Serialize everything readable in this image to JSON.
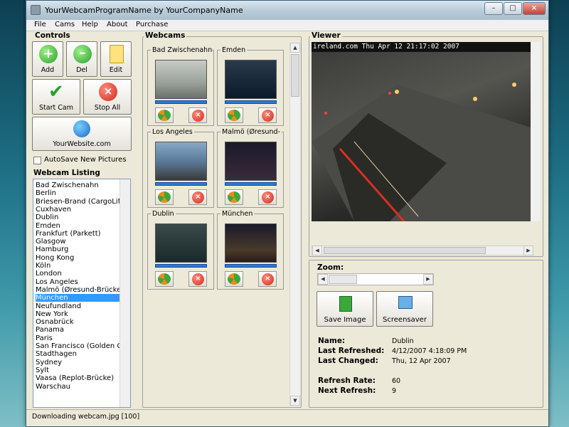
{
  "window": {
    "title": "YourWebcamProgramName by YourCompanyName",
    "min": "–",
    "max": "□",
    "close": "×"
  },
  "menu": [
    "File",
    "Cams",
    "Help",
    "About",
    "Purchase"
  ],
  "controls": {
    "title": "Controls",
    "add": "Add",
    "del": "Del",
    "edit": "Edit",
    "start": "Start Cam",
    "stop": "Stop All",
    "website": "YourWebsite.com",
    "autosave": "AutoSave New Pictures"
  },
  "listing": {
    "title": "Webcam Listing",
    "items": [
      "Bad Zwischenahn",
      "Berlin",
      "Briesen-Brand (CargoLifte",
      "Cuxhaven",
      "Dublin",
      "Emden",
      "Frankfurt (Parkett)",
      "Glasgow",
      "Hamburg",
      "Hong Kong",
      "Köln",
      "London",
      "Los Angeles",
      "Malmö (Øresund-Brücke)",
      "München",
      "Neufundland",
      "New York",
      "Osnabrück",
      "Panama",
      "Paris",
      "San Francisco (Golden Gat",
      "Stadthagen",
      "Sydney",
      "Sylt",
      "Vaasa (Replot-Brücke)",
      "Warschau"
    ],
    "selected": "München"
  },
  "webcams": {
    "title": "Webcams",
    "cams": [
      "Bad Zwischenahn",
      "Emden",
      "Los Angeles",
      "Malmö (Øresund-",
      "Dublin",
      "München"
    ]
  },
  "viewer": {
    "title": "Viewer",
    "overlay": "ireland.com   Thu Apr 12  21:17:02  2007",
    "zoom_label": "Zoom:",
    "save_image": "Save Image",
    "screensaver": "Screensaver"
  },
  "info": {
    "name_label": "Name:",
    "name": "Dublin",
    "refreshed_label": "Last Refreshed:",
    "refreshed": "4/12/2007 4:18:09 PM",
    "changed_label": "Last Changed:",
    "changed": "Thu, 12 Apr 2007",
    "rate_label": "Refresh Rate:",
    "rate": "60",
    "next_label": "Next Refresh:",
    "next": "9"
  },
  "status": "Downloading webcam.jpg [100]"
}
